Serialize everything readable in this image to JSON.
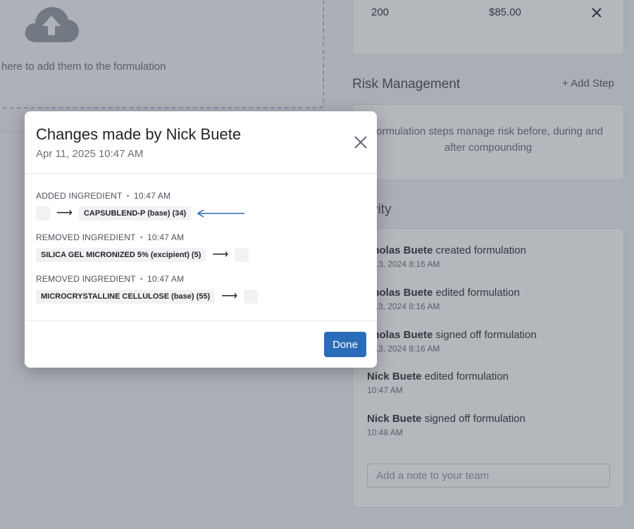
{
  "background": {
    "dropzone": {
      "text": "here to add them to the formulation",
      "icon": "cloud-upload-icon"
    },
    "pricing": {
      "quantity": "200",
      "price": "$85.00",
      "remove_icon": "close-icon"
    },
    "risk": {
      "title": "Risk Management",
      "add_step_label": "+ Add Step",
      "empty_text": "formulation steps manage risk before, during and after compounding"
    },
    "activity": {
      "title": "vity",
      "items": [
        {
          "user": "cholas Buete",
          "action": "created formulation",
          "time": "v 13, 2024 8:16 AM"
        },
        {
          "user": "cholas Buete",
          "action": "edited formulation",
          "time": "v 13, 2024 8:16 AM"
        },
        {
          "user": "cholas Buete",
          "action": "signed off formulation",
          "time": "v 13, 2024 8:16 AM"
        },
        {
          "user": "Nick Buete",
          "action": "edited formulation",
          "time": "10:47 AM"
        },
        {
          "user": "Nick Buete",
          "action": "signed off formulation",
          "time": "10:48 AM"
        }
      ],
      "note_placeholder": "Add a note to your team"
    }
  },
  "modal": {
    "title": "Changes made by Nick Buete",
    "subtitle": "Apr 11, 2025 10:47 AM",
    "close_icon": "close-icon",
    "changes": [
      {
        "type": "ADDED INGREDIENT",
        "time": "10:47 AM",
        "from": "",
        "to": "CAPSUBLEND-P (base) (34)"
      },
      {
        "type": "REMOVED INGREDIENT",
        "time": "10:47 AM",
        "from": "SILICA GEL MICRONIZED 5% (excipient) (5)",
        "to": ""
      },
      {
        "type": "REMOVED INGREDIENT",
        "time": "10:47 AM",
        "from": "MICROCRYSTALLINE CELLULOSE (base) (55)",
        "to": ""
      }
    ],
    "done_label": "Done"
  },
  "colors": {
    "primary": "#2b6cb8",
    "annotation_arrow": "#2b6cb8",
    "overlay": "#4c5460"
  }
}
